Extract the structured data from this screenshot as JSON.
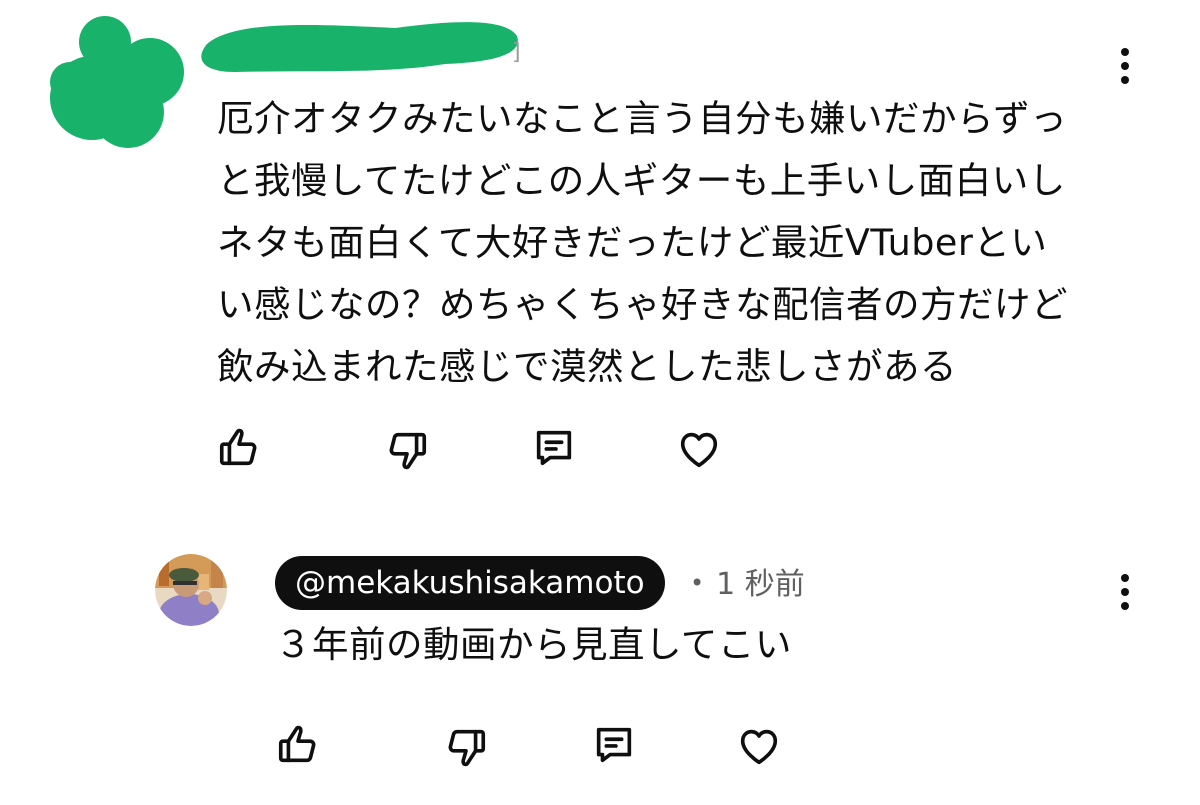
{
  "comment": {
    "author_suffix": "]",
    "lines": [
      "厄介オタクみたいなこと言う自分も嫌いだからずっ",
      "と我慢してたけどこの人ギターも上手いし面白いし",
      "ネタも面白くて大好きだったけど最近VTuberとい",
      "い感じなの？めちゃくちゃ好きな配信者の方だけど",
      "飲み込まれた感じで漠然とした悲しさがある"
    ],
    "redaction_color": "#18b26a"
  },
  "reply": {
    "author": "@mekakushisakamoto",
    "separator": "•",
    "timestamp": "1 秒前",
    "text": "３年前の動画から見直してこい"
  },
  "icons": {
    "like": "thumbs-up-icon",
    "dislike": "thumbs-down-icon",
    "reply": "comment-icon",
    "heart": "heart-icon",
    "more": "more-vertical-icon"
  }
}
